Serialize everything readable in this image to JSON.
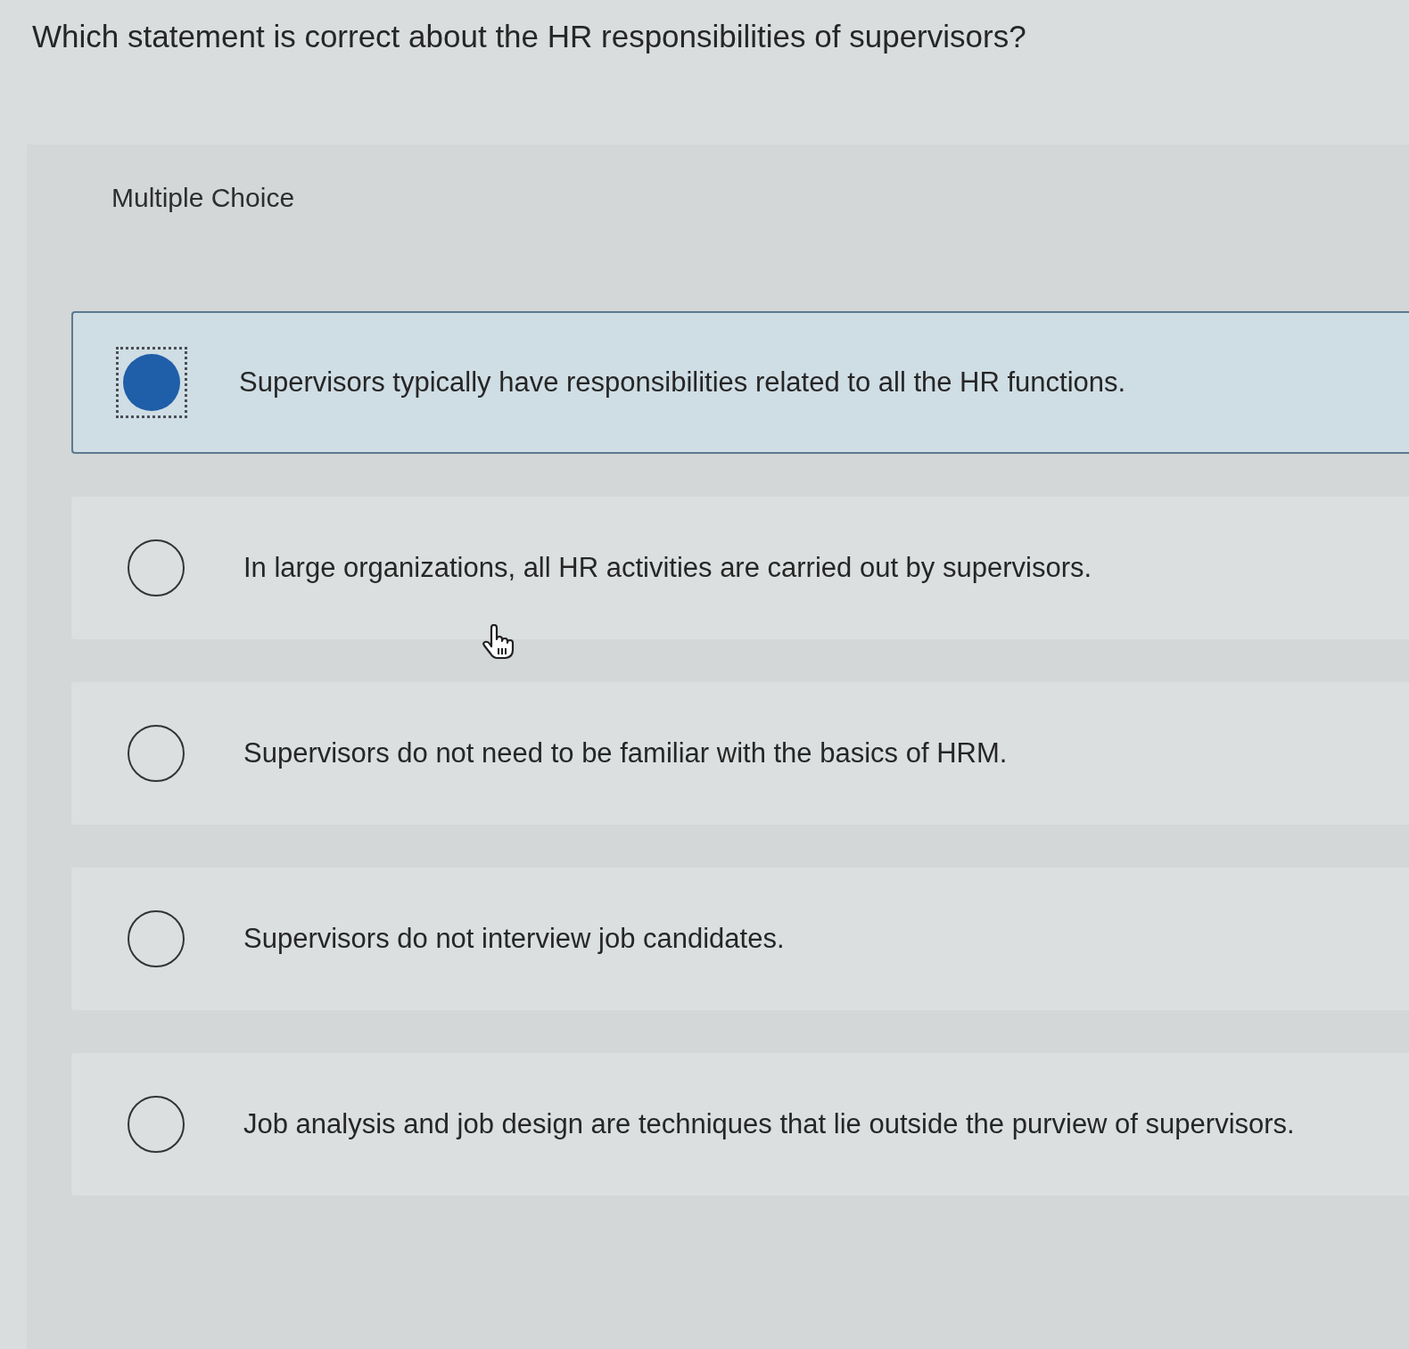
{
  "question": "Which statement is correct about the HR responsibilities of supervisors?",
  "question_type": "Multiple Choice",
  "options": [
    {
      "text": "Supervisors typically have responsibilities related to all the HR functions.",
      "selected": true
    },
    {
      "text": "In large organizations, all HR activities are carried out by supervisors.",
      "selected": false
    },
    {
      "text": "Supervisors do not need to be familiar with the basics of HRM.",
      "selected": false
    },
    {
      "text": "Supervisors do not interview job candidates.",
      "selected": false
    },
    {
      "text": "Job analysis and job design are techniques that lie outside the purview of supervisors.",
      "selected": false
    }
  ]
}
